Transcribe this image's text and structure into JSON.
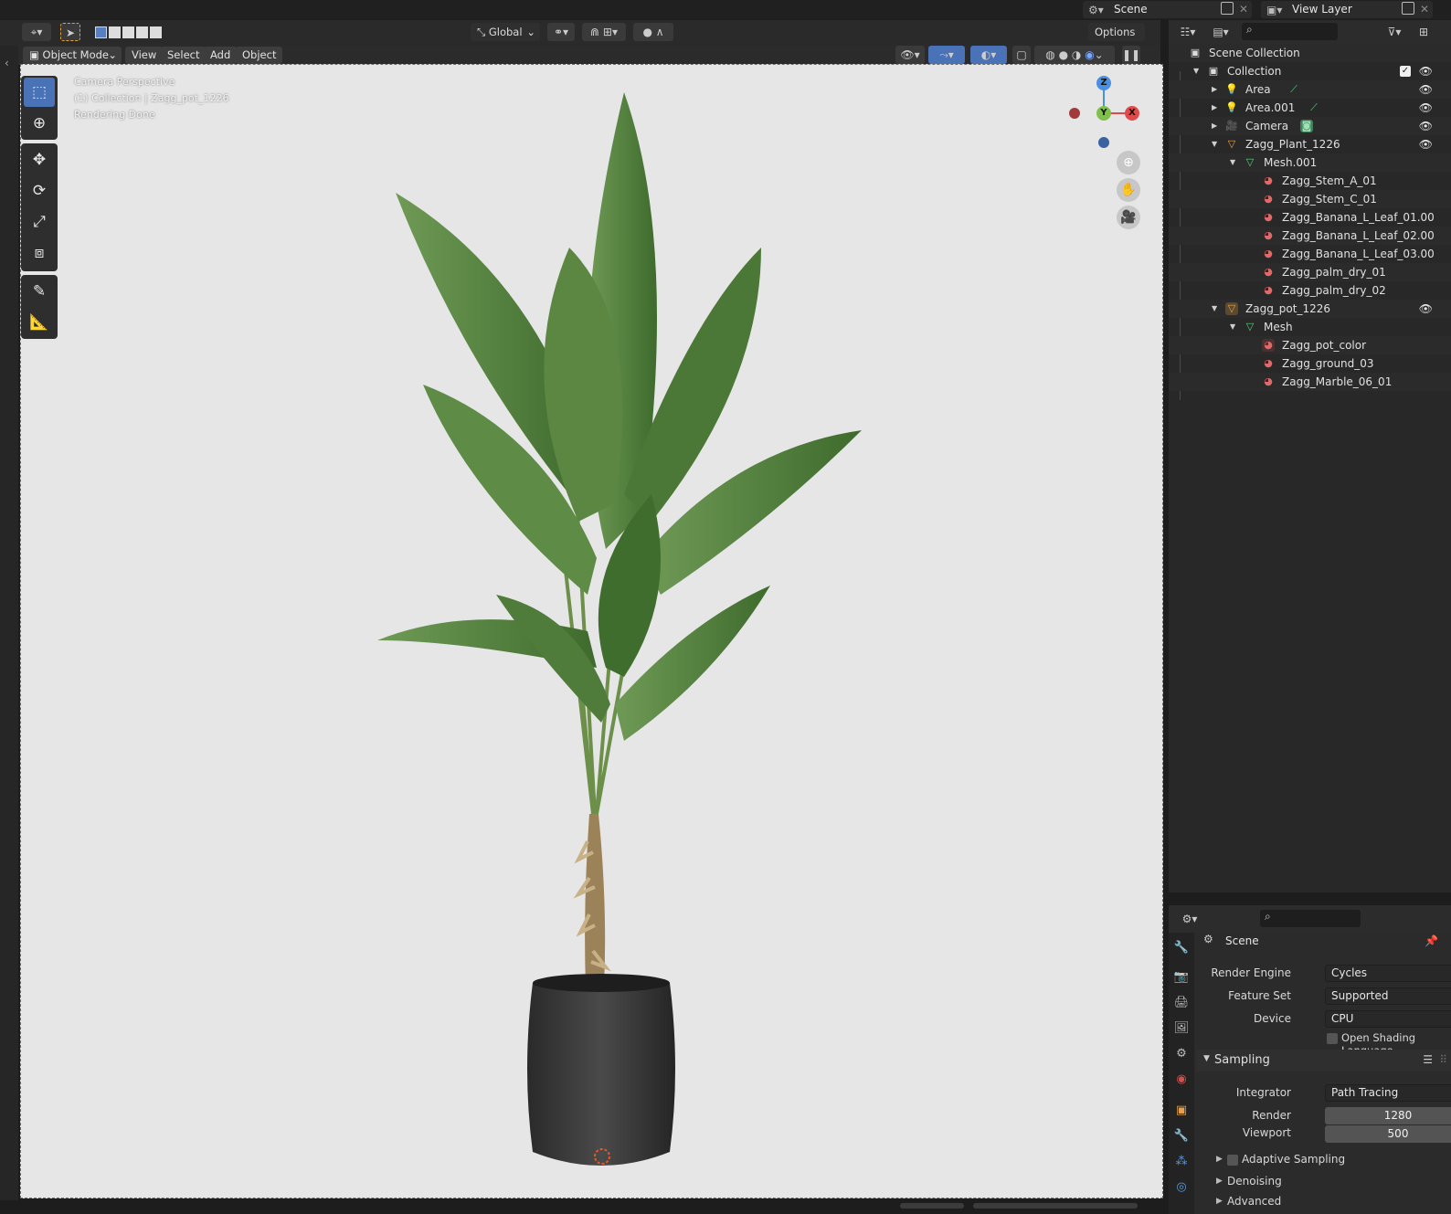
{
  "topbar": {
    "scene_label": "Scene",
    "viewlayer_label": "View Layer"
  },
  "header": {
    "transform_orientation": "Global",
    "options_label": "Options"
  },
  "menus": {
    "mode": "Object Mode",
    "view": "View",
    "select": "Select",
    "add": "Add",
    "object": "Object"
  },
  "overlay": {
    "line1": "Camera Perspective",
    "line2": "(1) Collection | Zagg_pot_1226",
    "line3": "Rendering Done"
  },
  "gizmo": {
    "z": "Z",
    "y": "Y",
    "x": "X"
  },
  "outliner": {
    "rows": [
      {
        "label": "Scene Collection"
      },
      {
        "label": "Collection"
      },
      {
        "label": "Area"
      },
      {
        "label": "Area.001"
      },
      {
        "label": "Camera"
      },
      {
        "label": "Zagg_Plant_1226"
      },
      {
        "label": "Mesh.001"
      },
      {
        "label": "Zagg_Stem_A_01"
      },
      {
        "label": "Zagg_Stem_C_01"
      },
      {
        "label": "Zagg_Banana_L_Leaf_01.00"
      },
      {
        "label": "Zagg_Banana_L_Leaf_02.00"
      },
      {
        "label": "Zagg_Banana_L_Leaf_03.00"
      },
      {
        "label": "Zagg_palm_dry_01"
      },
      {
        "label": "Zagg_palm_dry_02"
      },
      {
        "label": "Zagg_pot_1226"
      },
      {
        "label": "Mesh"
      },
      {
        "label": "Zagg_pot_color"
      },
      {
        "label": "Zagg_ground_03"
      },
      {
        "label": "Zagg_Marble_06_01"
      }
    ]
  },
  "properties": {
    "context": "Scene",
    "render_engine_label": "Render Engine",
    "render_engine": "Cycles",
    "feature_set_label": "Feature Set",
    "feature_set": "Supported",
    "device_label": "Device",
    "device": "CPU",
    "osl_label": "Open Shading Language",
    "sampling_label": "Sampling",
    "integrator_label": "Integrator",
    "integrator": "Path Tracing",
    "render_label": "Render",
    "render_samples": "1280",
    "viewport_label": "Viewport",
    "viewport_samples": "500",
    "adaptive_label": "Adaptive Sampling",
    "denoising_label": "Denoising",
    "advanced_label": "Advanced"
  },
  "colors": {
    "accent": "#4a72b7",
    "viewport_bg": "#e6e6e6",
    "leaf": "#4f7a3a"
  }
}
